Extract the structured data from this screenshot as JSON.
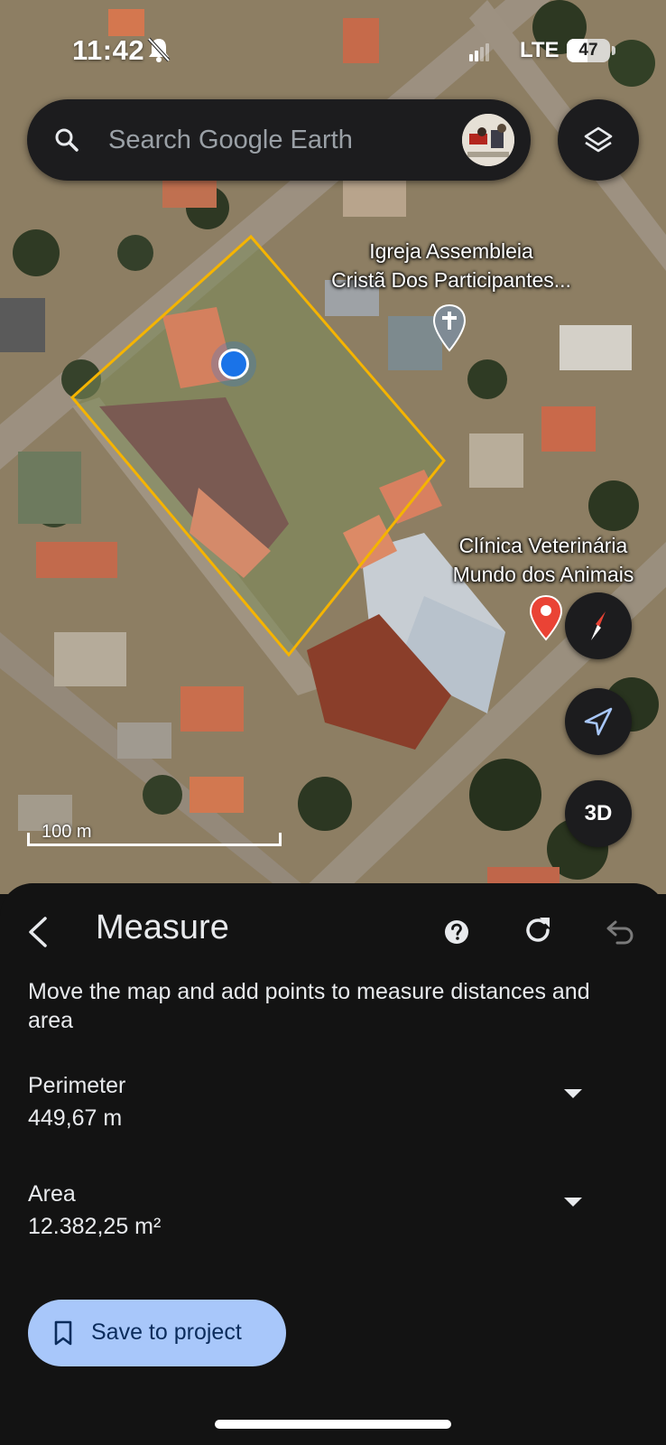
{
  "status_bar": {
    "time": "11:42",
    "network": "LTE",
    "battery": "47",
    "battery_fraction": 0.47
  },
  "search": {
    "placeholder": "Search Google Earth"
  },
  "map": {
    "labels": {
      "church": [
        "Igreja Assembleia",
        "Cristã Dos Participantes..."
      ],
      "clinic": [
        "Clínica Veterinária",
        "Mundo dos Animais"
      ]
    },
    "scale": "100 m",
    "threed_label": "3D",
    "polygon_color": "#f5b400",
    "location_dot_color": "#1a73e8"
  },
  "measure": {
    "title": "Measure",
    "instructions": "Move the map and add points to measure distances and area",
    "perimeter": {
      "label": "Perimeter",
      "value": "449,67 m"
    },
    "area": {
      "label": "Area",
      "value": "12.382,25 m²"
    },
    "save_label": "Save to project"
  },
  "icons": [
    "bell-off-icon",
    "signal-icon",
    "search-icon",
    "layers-icon",
    "cross-icon",
    "map-pin-icon",
    "compass-icon",
    "navigation-arrow-icon",
    "back-arrow-icon",
    "help-icon",
    "refresh-icon",
    "undo-icon",
    "chevron-down-icon",
    "bookmark-icon"
  ],
  "colors": {
    "sheet_bg": "#131313",
    "accent": "#a8c7fa",
    "polygon": "#f5b400"
  }
}
